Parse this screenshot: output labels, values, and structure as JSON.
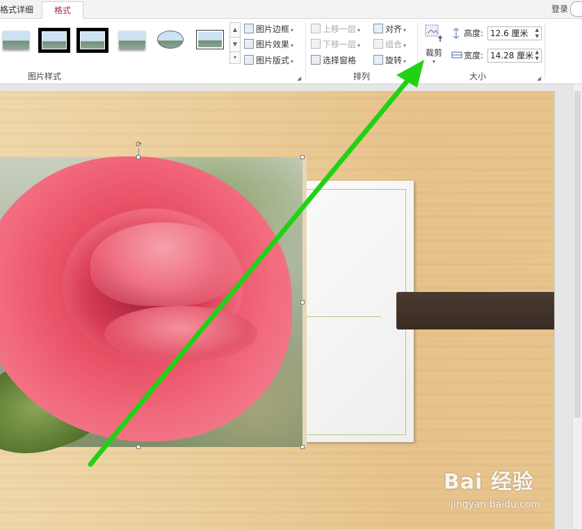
{
  "tabs": {
    "prev_label": "格式详细",
    "active_label": "格式"
  },
  "account": {
    "login_label": "登录"
  },
  "ribbon": {
    "picture_styles": {
      "group_label": "图片样式",
      "commands": {
        "border": "图片边框",
        "effects": "图片效果",
        "layout": "图片版式"
      }
    },
    "arrange": {
      "group_label": "排列",
      "commands": {
        "bring_forward": "上移一层",
        "send_backward": "下移一层",
        "selection_pane": "选择窗格",
        "align": "对齐",
        "group": "组合",
        "rotate": "旋转"
      }
    },
    "size": {
      "group_label": "大小",
      "crop_label": "裁剪",
      "height_label": "高度:",
      "height_value": "12.6 厘米",
      "width_label": "宽度:",
      "width_value": "14.28 厘米"
    }
  },
  "watermark": {
    "brand": "Bai 经验",
    "url": "jingyan.baidu.com"
  },
  "colors": {
    "accent_tab": "#9b2a56",
    "arrow": "#22d116"
  }
}
